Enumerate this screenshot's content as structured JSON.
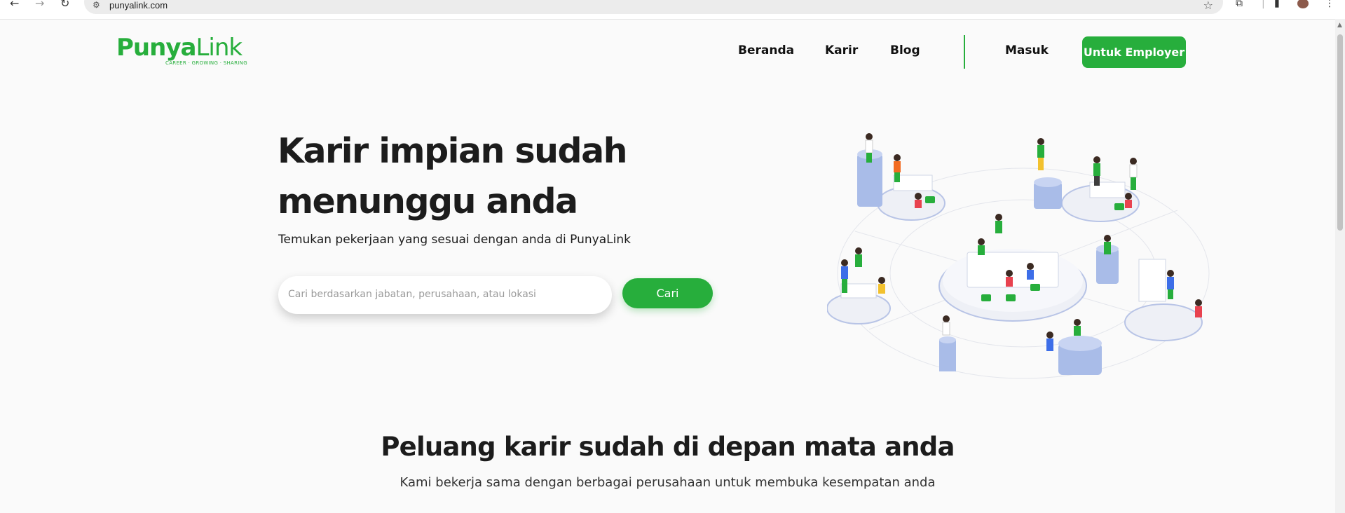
{
  "browser": {
    "url": "punyalink.com"
  },
  "header": {
    "logo_text_bold": "Punya",
    "logo_text_light": "Link",
    "logo_tagline": "CAREER · GROWING · SHARING",
    "nav": {
      "beranda": "Beranda",
      "karir": "Karir",
      "blog": "Blog",
      "masuk": "Masuk"
    },
    "employer_button": "Untuk Employer"
  },
  "hero": {
    "title_line1": "Karir impian sudah",
    "title_line2": "menunggu anda",
    "subtitle": "Temukan pekerjaan yang sesuai dengan anda di PunyaLink",
    "search_placeholder": "Cari berdasarkan jabatan, perusahaan, atau lokasi",
    "search_button": "Cari"
  },
  "section": {
    "title": "Peluang karir sudah di depan mata anda",
    "subtitle": "Kami bekerja sama dengan berbagai perusahaan untuk membuka kesempatan anda"
  },
  "colors": {
    "brand_green": "#27ae3c",
    "text_dark": "#1c1c1c",
    "page_bg": "#fafafa"
  },
  "icons": [
    "back-arrow-icon",
    "forward-arrow-icon",
    "reload-icon",
    "site-info-icon",
    "bookmark-star-icon",
    "extensions-icon",
    "side-panel-icon",
    "profile-avatar-icon"
  ]
}
